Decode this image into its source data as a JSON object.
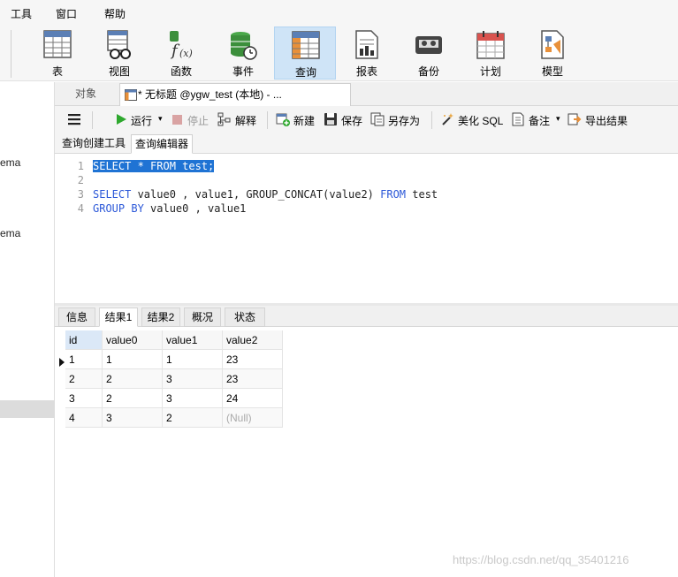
{
  "menu": [
    "工具",
    "窗口",
    "帮助"
  ],
  "ribbon": [
    {
      "label": "表",
      "icon": "table-icon"
    },
    {
      "label": "视图",
      "icon": "view-icon"
    },
    {
      "label": "函数",
      "icon": "function-icon"
    },
    {
      "label": "事件",
      "icon": "event-icon"
    },
    {
      "label": "查询",
      "icon": "query-icon"
    },
    {
      "label": "报表",
      "icon": "report-icon"
    },
    {
      "label": "备份",
      "icon": "backup-icon"
    },
    {
      "label": "计划",
      "icon": "schedule-icon"
    },
    {
      "label": "模型",
      "icon": "model-icon"
    }
  ],
  "left_panel": {
    "items": [
      "ema",
      "ema"
    ]
  },
  "tabs": {
    "objects": "对象",
    "query_tab": "* 无标题 @ygw_test (本地) - ..."
  },
  "toolbar": {
    "menu": "",
    "run": "运行",
    "run_arrow": "▾",
    "stop": "停止",
    "explain": "解释",
    "new": "新建",
    "save": "保存",
    "save_as": "另存为",
    "beautify": "美化 SQL",
    "comment": "备注",
    "comment_arrow": "▾",
    "export": "导出结果"
  },
  "subtabs": {
    "builder": "查询创建工具",
    "editor": "查询编辑器"
  },
  "editor": {
    "lines": [
      {
        "n": "1",
        "text": "SELECT * FROM test;"
      },
      {
        "n": "2",
        "text": ""
      },
      {
        "n": "3",
        "text": "SELECT value0 , value1, GROUP_CONCAT(value2) FROM test"
      },
      {
        "n": "4",
        "text": "GROUP BY value0 , value1"
      }
    ]
  },
  "result_tabs": [
    "信息",
    "结果1",
    "结果2",
    "概况",
    "状态"
  ],
  "grid": {
    "columns": [
      "id",
      "value0",
      "value1",
      "value2"
    ],
    "rows": [
      [
        "1",
        "1",
        "1",
        "23"
      ],
      [
        "2",
        "2",
        "3",
        "23"
      ],
      [
        "3",
        "2",
        "3",
        "24"
      ],
      [
        "4",
        "3",
        "2",
        "(Null)"
      ]
    ]
  },
  "watermark": "https://blog.csdn.net/qq_35401216",
  "colors": {
    "accent": "#1f73d4",
    "keyword": "#2c58d8",
    "run_green": "#2ea82e",
    "active_ribbon": "#cfe4f7"
  }
}
